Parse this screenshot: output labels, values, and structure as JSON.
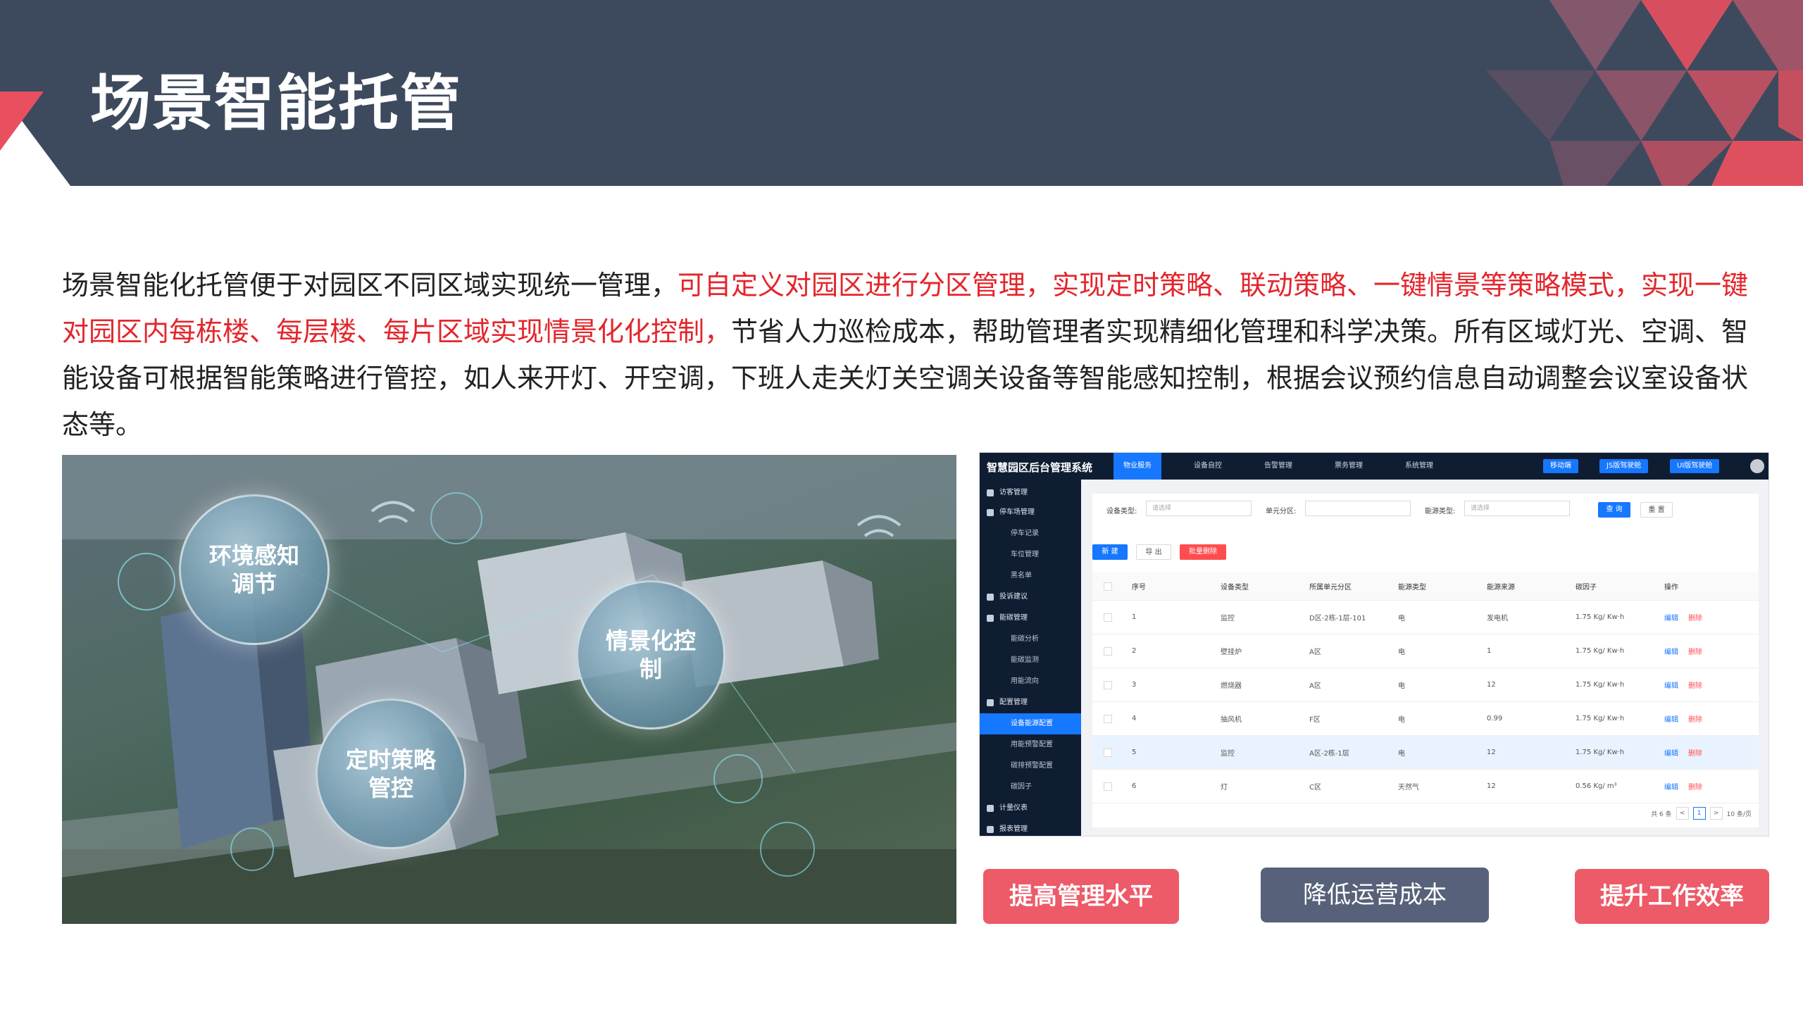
{
  "header": {
    "title": "场景智能托管",
    "colors": {
      "band": "#3d4a5e",
      "accent": "#e8505f"
    }
  },
  "intro": {
    "part1": "场景智能化托管便于对园区不同区域实现统一管理，",
    "highlight": "可自定义对园区进行分区管理，实现定时策略、联动策略、一键情景等策略模式，实现一键对园区内每栋楼、每层楼、每片区域实现情景化化控制，",
    "part2": "节省人力巡检成本，帮助管理者实现精细化管理和科学决策。所有区域灯光、空调、智能设备可根据智能策略进行管控，如人来开灯、开空调，下班人走关灯关空调关设备等智能感知控制，根据会议预约信息自动调整会议室设备状态等。",
    "highlight_color": "#e3262c"
  },
  "scene": {
    "bubbles": {
      "env": "环境感知调节",
      "scene": "情景化控制",
      "timer": "定时策略管控"
    }
  },
  "admin": {
    "logo": "智慧园区后台管理系统",
    "nav": [
      "物业服务",
      "设备自控",
      "告警管理",
      "票务管理",
      "系统管理"
    ],
    "top_buttons": [
      "移动端",
      "JS版驾驶舱",
      "UI版驾驶舱"
    ],
    "sidebar": [
      "访客管理",
      "停车场管理",
      "停车记录",
      "车位管理",
      "黑名单",
      "投诉建议",
      "能碳管理",
      "能碳分析",
      "能碳监测",
      "用能流向",
      "配置管理",
      "设备能源配置",
      "用能预警配置",
      "碳排预警配置",
      "碳因子",
      "计量仪表",
      "报表管理"
    ],
    "filters": {
      "device_type_label": "设备类型:",
      "device_type_placeholder": "请选择",
      "unit_label": "单元分区:",
      "energy_type_label": "能源类型:",
      "energy_type_placeholder": "请选择",
      "search": "查 询",
      "reset": "重 置"
    },
    "actions": {
      "new": "新 建",
      "export": "导 出",
      "batch_delete": "批量删除"
    },
    "columns": [
      "序号",
      "设备类型",
      "所属单元分区",
      "能源类型",
      "能源来源",
      "碳因子",
      "操作"
    ],
    "rows": [
      [
        "1",
        "监控",
        "D区-2栋-1层-101",
        "电",
        "发电机",
        "1.75 Kg/ Kw·h"
      ],
      [
        "2",
        "壁挂炉",
        "A区",
        "电",
        "1",
        "1.75 Kg/ Kw·h"
      ],
      [
        "3",
        "燃烧器",
        "A区",
        "电",
        "12",
        "1.75 Kg/ Kw·h"
      ],
      [
        "4",
        "抽风机",
        "F区",
        "电",
        "0.99",
        "1.75 Kg/ Kw·h"
      ],
      [
        "5",
        "监控",
        "A区-2栋-1层",
        "电",
        "12",
        "1.75 Kg/ Kw·h"
      ],
      [
        "6",
        "灯",
        "C区",
        "天然气",
        "12",
        "0.56 Kg/ m³"
      ]
    ],
    "op_edit": "编辑",
    "op_delete": "删除",
    "pager": {
      "total": "共 6 条",
      "page": "1",
      "size": "10 条/页",
      "prev": "<",
      "next": ">"
    }
  },
  "cta": {
    "left": "提高管理水平",
    "middle": "降低运营成本",
    "right": "提升工作效率"
  }
}
